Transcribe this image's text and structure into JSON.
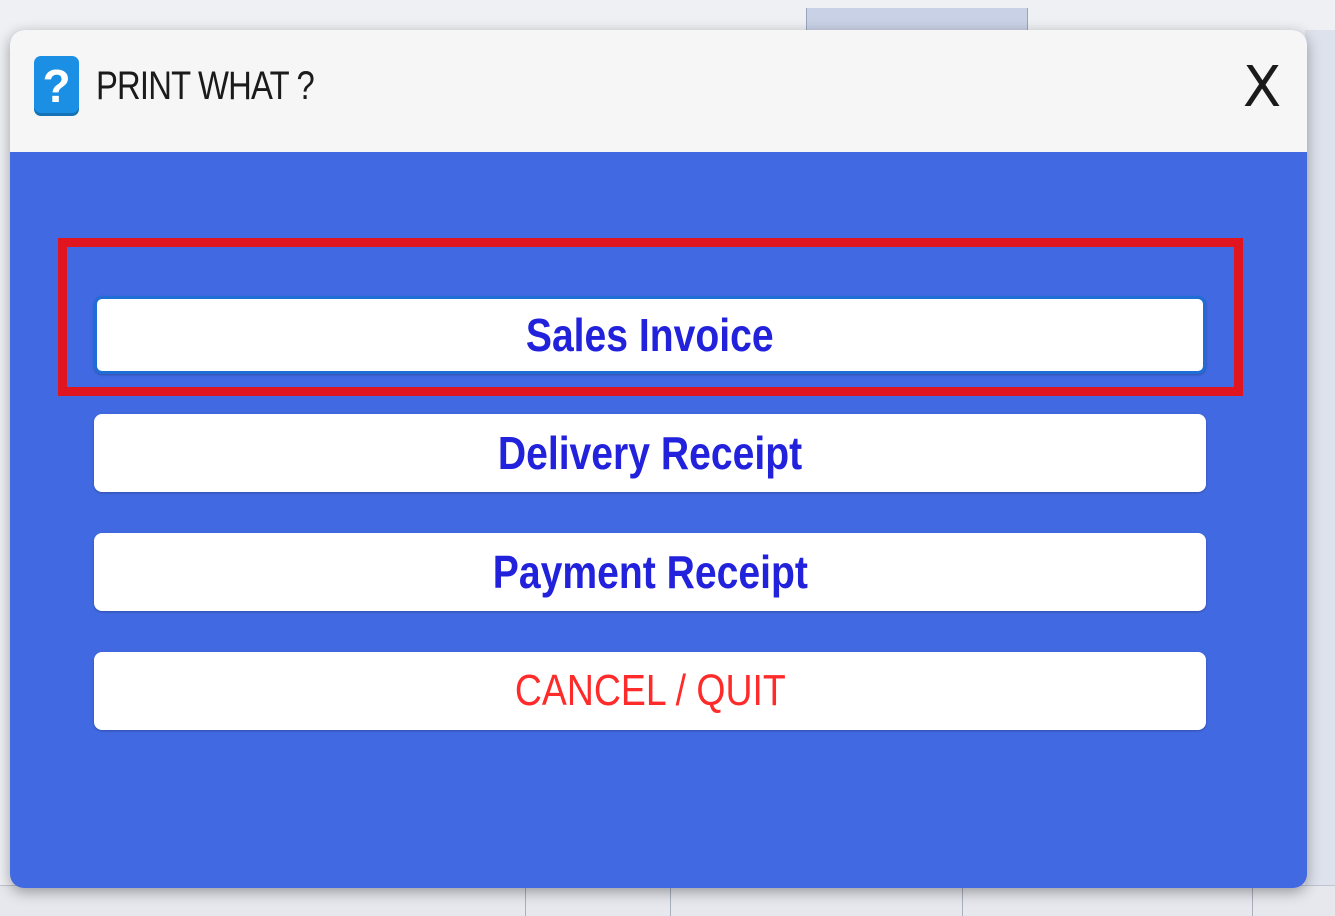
{
  "dialog": {
    "title": "PRINT WHAT ?",
    "icon": "question-icon",
    "icon_glyph": "?",
    "close_glyph": "X"
  },
  "options": {
    "sales_invoice": "Sales Invoice",
    "delivery_receipt": "Delivery Receipt",
    "payment_receipt": "Payment Receipt",
    "cancel": "CANCEL / QUIT"
  },
  "colors": {
    "dialog_body": "#4169e1",
    "button_text": "#2222dd",
    "cancel_text": "#ff2a2a",
    "highlight": "#e0151f"
  },
  "highlighted_option": "Sales Invoice"
}
